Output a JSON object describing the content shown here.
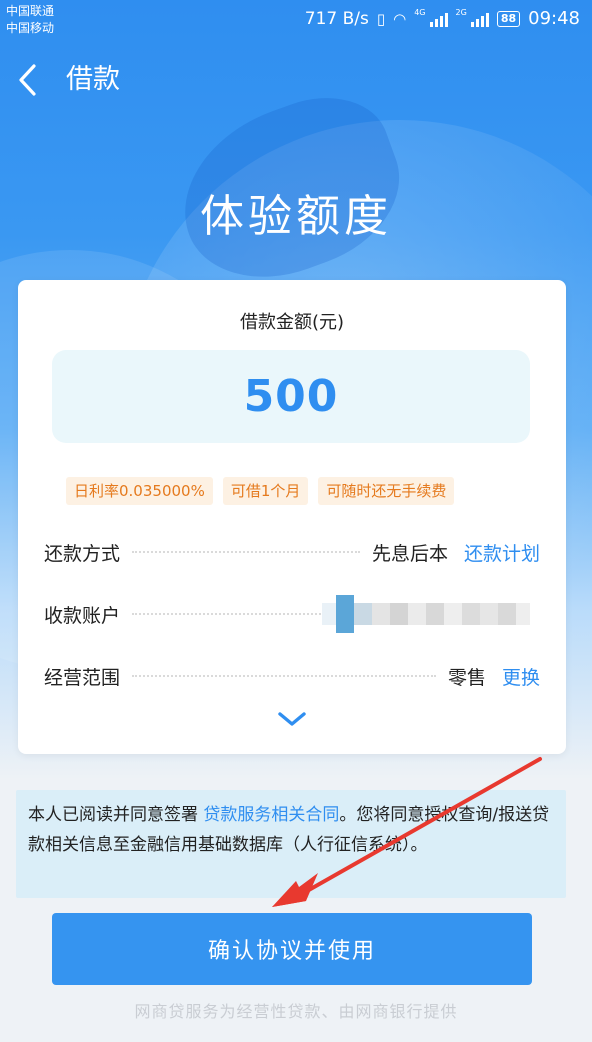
{
  "statusbar": {
    "carrier_1": "中国联通",
    "carrier_2": "中国移动",
    "net_speed": "717 B/s",
    "net_tag_1": "4G",
    "net_tag_2": "2G",
    "battery": "88",
    "time": "09:48"
  },
  "header": {
    "title": "借款",
    "back_icon": "chevron-left-icon"
  },
  "hero": {
    "title": "体验额度"
  },
  "loan": {
    "amount_label": "借款金额(元)",
    "amount_value": "500",
    "tags": [
      "日利率0.035000%",
      "可借1个月",
      "可随时还无手续费"
    ],
    "repay": {
      "label": "还款方式",
      "value": "先息后本",
      "link": "还款计划"
    },
    "account": {
      "label": "收款账户"
    },
    "scope": {
      "label": "经营范围",
      "value": "零售",
      "link": "更换"
    },
    "expand_icon": "chevron-down-icon"
  },
  "agreement": {
    "prefix": "本人已阅读并同意签署 ",
    "link": "贷款服务相关合同",
    "suffix": "。您将同意授权查询/报送贷款相关信息至金融信用基础数据库（人行征信系统）。"
  },
  "confirm_button": "确认协议并使用",
  "footer_note": "网商贷服务为经营性贷款、由网商银行提供",
  "colors": {
    "primary": "#2f8ef0",
    "tag_text": "#e57a1e",
    "tag_bg": "#fdf1e3",
    "annotation_arrow": "#e8392f"
  }
}
